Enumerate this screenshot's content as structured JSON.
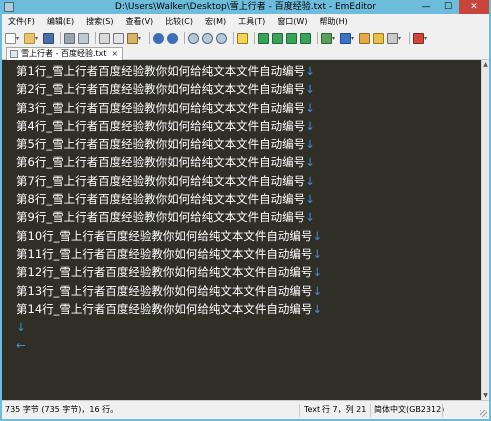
{
  "window": {
    "title": "D:\\Users\\Walker\\Desktop\\雪上行者 - 百度经验.txt - EmEditor",
    "minimize": "—",
    "maximize": "☐",
    "close": "✕"
  },
  "menu": [
    "文件(F)",
    "编辑(E)",
    "搜索(S)",
    "查看(V)",
    "比较(C)",
    "宏(M)",
    "工具(T)",
    "窗口(W)",
    "帮助(H)"
  ],
  "tab": {
    "label": "雪上行者 - 百度经验.txt",
    "close": "×"
  },
  "toolbar_icons": [
    "new-icon",
    "open-icon",
    "save-icon",
    "print-icon",
    "print-preview-icon",
    "cut-icon",
    "copy-icon",
    "paste-icon",
    "undo-icon",
    "redo-icon",
    "find-icon",
    "find-next-icon",
    "find-prev-icon",
    "highlight-icon",
    "view-icon",
    "view-icon",
    "view-icon",
    "view-icon",
    "bookmark-icon",
    "macro-icon",
    "tools-icon",
    "wrap-icon",
    "settings-icon",
    "plugin-icon"
  ],
  "editor": {
    "lines": [
      "第1行_雪上行者百度经验教你如何给纯文本文件自动编号",
      "第2行_雪上行者百度经验教你如何给纯文本文件自动编号",
      "第3行_雪上行者百度经验教你如何给纯文本文件自动编号",
      "第4行_雪上行者百度经验教你如何给纯文本文件自动编号",
      "第5行_雪上行者百度经验教你如何给纯文本文件自动编号",
      "第6行_雪上行者百度经验教你如何给纯文本文件自动编号",
      "第7行_雪上行者百度经验教你如何给纯文本文件自动编号",
      "第8行_雪上行者百度经验教你如何给纯文本文件自动编号",
      "第9行_雪上行者百度经验教你如何给纯文本文件自动编号",
      "第10行_雪上行者百度经验教你如何给纯文本文件自动编号",
      "第11行_雪上行者百度经验教你如何给纯文本文件自动编号",
      "第12行_雪上行者百度经验教你如何给纯文本文件自动编号",
      "第13行_雪上行者百度经验教你如何给纯文本文件自动编号",
      "第14行_雪上行者百度经验教你如何给纯文本文件自动编号"
    ],
    "eol_mark": "↓",
    "empty_line_mark": "↓",
    "eof_mark": "←",
    "background": "#2f2f28",
    "text_color": "#ffffff",
    "mark_color": "#4a8ad0"
  },
  "status": {
    "size": "735 字节 (735 字节)，16 行。",
    "mode": "Text",
    "position": "行 7，列 21",
    "encoding": "简体中文(GB2312)"
  }
}
